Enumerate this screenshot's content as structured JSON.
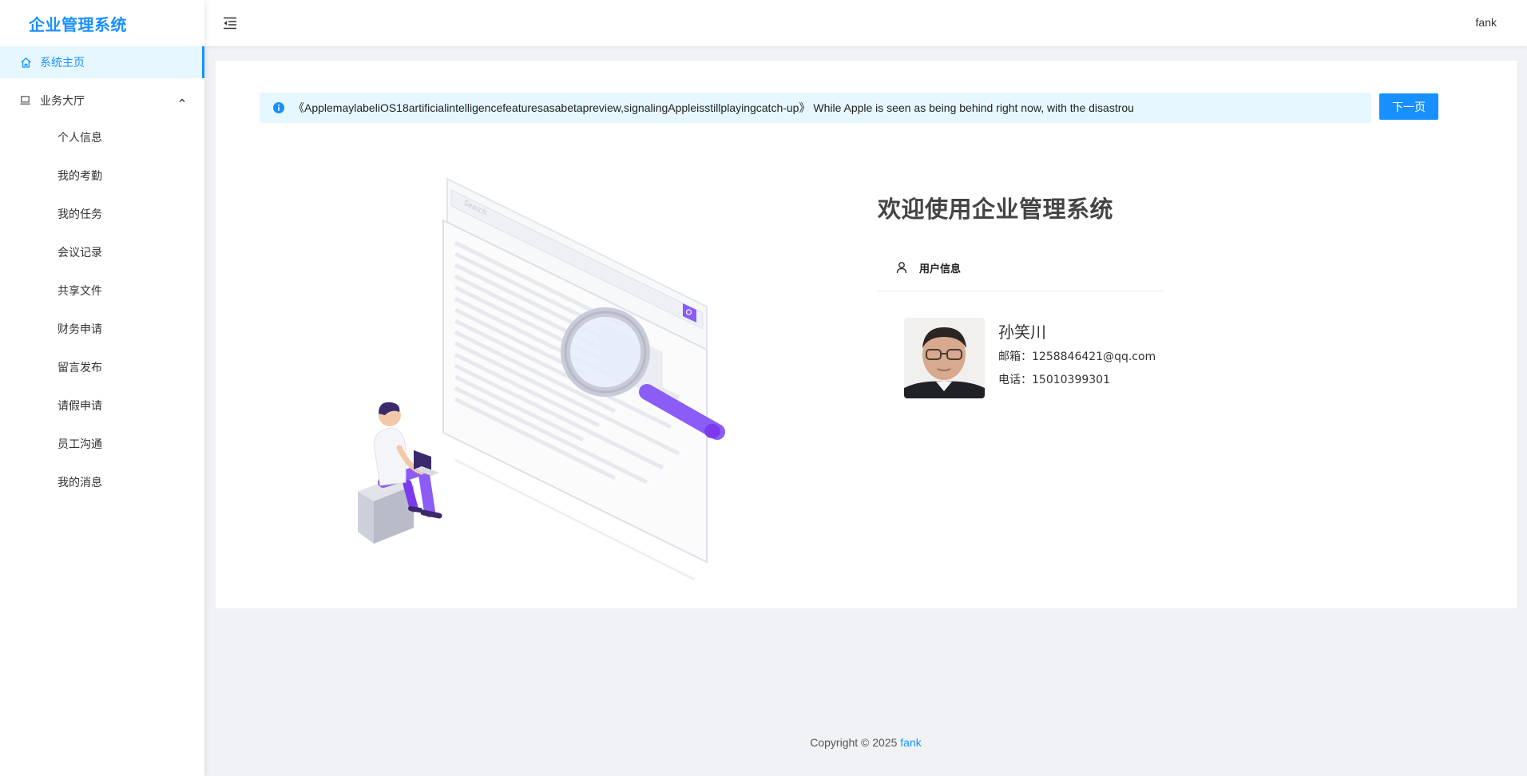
{
  "app": {
    "title": "企业管理系统"
  },
  "sidebar": {
    "home": {
      "label": "系统主页"
    },
    "business": {
      "label": "业务大厅",
      "items": [
        {
          "label": "个人信息"
        },
        {
          "label": "我的考勤"
        },
        {
          "label": "我的任务"
        },
        {
          "label": "会议记录"
        },
        {
          "label": "共享文件"
        },
        {
          "label": "财务申请"
        },
        {
          "label": "留言发布"
        },
        {
          "label": "请假申请"
        },
        {
          "label": "员工沟通"
        },
        {
          "label": "我的消息"
        }
      ]
    }
  },
  "header": {
    "user": "fank"
  },
  "notice": {
    "text": "《ApplemaylabeliOS18artificialintelligencefeaturesasabetapreview,signalingAppleisstillplayingcatch-up》 While Apple is seen as being behind right now, with the disastrou",
    "next_label": "下一页"
  },
  "illustration": {
    "search_text": "Search"
  },
  "welcome": {
    "title": "欢迎使用企业管理系统",
    "tab_label": "用户信息"
  },
  "profile": {
    "name": "孙笑川",
    "email_line": "邮箱：1258846421@qq.com",
    "phone_line": "电话：15010399301"
  },
  "footer": {
    "copyright": "Copyright © 2025 ",
    "link": "fank"
  },
  "colors": {
    "primary": "#1890ff",
    "active_bg": "#e6f7ff",
    "page_bg": "#f0f2f5",
    "illustration_accent": "#8b5cf6"
  }
}
